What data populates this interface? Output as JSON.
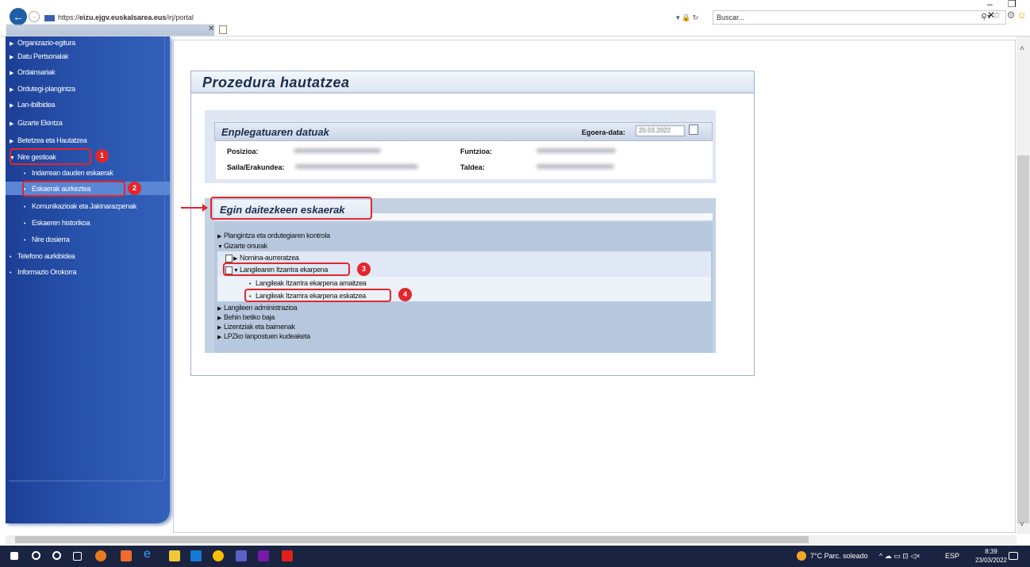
{
  "browser": {
    "url_prefix": "https://",
    "url_host": "eizu.ejgv.euskalsarea.eus",
    "url_path": "/irj/portal",
    "url_actions": "▾ 🔒 ↻",
    "search_placeholder": "Buscar...",
    "window_controls": "– ❐ ✕",
    "toolbar_icons": "⌂ ☆ ⚙"
  },
  "sidebar": {
    "items": [
      {
        "label": "Organizazio-egitura",
        "type": "collapsed"
      },
      {
        "label": "Datu Pertsonalak",
        "type": "collapsed"
      },
      {
        "label": "Ordainsariak",
        "type": "collapsed"
      },
      {
        "label": "Ordutegi-plangintza",
        "type": "collapsed"
      },
      {
        "label": "Lan-ibilbidea",
        "type": "collapsed"
      },
      {
        "label": "Gizarte Ekintza",
        "type": "collapsed"
      },
      {
        "label": "Betetzea eta Hautatzea",
        "type": "collapsed"
      },
      {
        "label": "Nire gestioak",
        "type": "expanded"
      },
      {
        "label": "Indarrean dauden eskaerak",
        "type": "sub"
      },
      {
        "label": "Eskaerak aurkeztea",
        "type": "sub-selected"
      },
      {
        "label": "Komunikazioak eta Jakinarazpenak",
        "type": "sub"
      },
      {
        "label": "Eskaeren historikoa",
        "type": "sub"
      },
      {
        "label": "Nire dosierra",
        "type": "sub"
      },
      {
        "label": "Telefono aurkibidea",
        "type": "bullet"
      },
      {
        "label": "Informazio Orokorra",
        "type": "bullet"
      }
    ]
  },
  "page": {
    "title": "Prozedura hautatzea",
    "employee_section": {
      "title": "Enplegatuaren datuak",
      "date_label": "Egoera-data:",
      "date_value": "20.03.2022",
      "fields": {
        "posizioa": "Posizioa:",
        "funtzioa": "Funtzioa:",
        "saila": "Saila/Erakundea:",
        "taldea": "Taldea:"
      }
    },
    "requests_section": {
      "title": "Egin daitezkeen eskaerak",
      "tree": [
        {
          "label": "Plangintza eta ordutegiaren kontrola",
          "expander": "▶"
        },
        {
          "label": "Gizarte onurak",
          "expander": "▼"
        },
        {
          "label": "Nomina-aurreratzea",
          "expander": "▶"
        },
        {
          "label": "Langilearen Itzarrira ekarpena",
          "expander": "▼"
        },
        {
          "label": "Langileak Itzarrira ekarpena amaitzea",
          "expander": "•"
        },
        {
          "label": "Langileak Itzarrira ekarpena eskatzea",
          "expander": "•"
        },
        {
          "label": "Langileen administrazioa",
          "expander": "▶"
        },
        {
          "label": "Behin betiko baja",
          "expander": "▶"
        },
        {
          "label": "Lizentziak eta baimenak",
          "expander": "▶"
        },
        {
          "label": "LPZko lanpostuen kudeaketa",
          "expander": "▶"
        }
      ]
    }
  },
  "annotations": [
    "1",
    "2",
    "3",
    "4"
  ],
  "taskbar": {
    "weather": "7°C  Parc. soleado",
    "lang": "ESP",
    "time": "8:39",
    "date": "23/03/2022"
  },
  "colors": {
    "sidebar": "#2a56b0",
    "highlight": "#e3262d",
    "selected": "#5b86d6"
  }
}
